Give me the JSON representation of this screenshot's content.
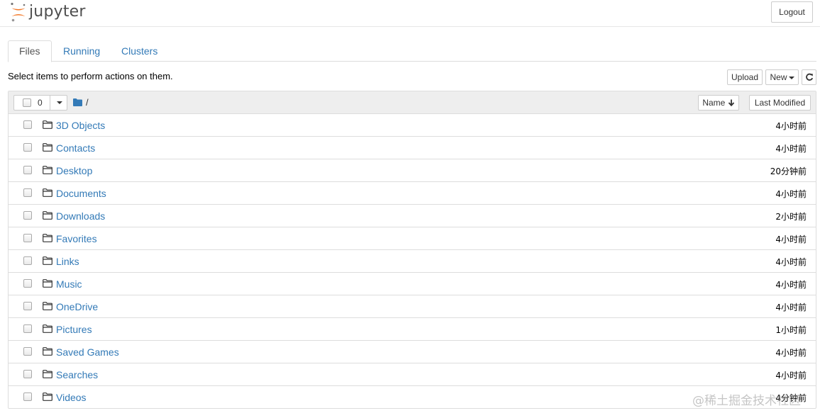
{
  "header": {
    "logo_text": "jupyter",
    "logout_label": "Logout"
  },
  "tabs": [
    {
      "label": "Files"
    },
    {
      "label": "Running"
    },
    {
      "label": "Clusters"
    }
  ],
  "toolbar": {
    "instructions": "Select items to perform actions on them.",
    "upload_label": "Upload",
    "new_label": "New"
  },
  "list_header": {
    "selected_count": "0",
    "breadcrumb_path": "/",
    "sort_name_label": "Name",
    "sort_modified_label": "Last Modified"
  },
  "items": [
    {
      "name": "3D Objects",
      "modified": "4小时前"
    },
    {
      "name": "Contacts",
      "modified": "4小时前"
    },
    {
      "name": "Desktop",
      "modified": "20分钟前"
    },
    {
      "name": "Documents",
      "modified": "4小时前"
    },
    {
      "name": "Downloads",
      "modified": "2小时前"
    },
    {
      "name": "Favorites",
      "modified": "4小时前"
    },
    {
      "name": "Links",
      "modified": "4小时前"
    },
    {
      "name": "Music",
      "modified": "4小时前"
    },
    {
      "name": "OneDrive",
      "modified": "4小时前"
    },
    {
      "name": "Pictures",
      "modified": "1小时前"
    },
    {
      "name": "Saved Games",
      "modified": "4小时前"
    },
    {
      "name": "Searches",
      "modified": "4小时前"
    },
    {
      "name": "Videos",
      "modified": "4分钟前"
    }
  ],
  "watermark": "@稀土掘金技术社区",
  "colors": {
    "link": "#337ab7",
    "logo_orange": "#f37726",
    "header_bg": "#eeeeee",
    "border": "#dddddd"
  },
  "icons": {
    "folder": "folder-outline-icon",
    "breadcrumb": "folder-solid-icon",
    "refresh": "refresh-icon",
    "sort": "arrow-down-icon"
  }
}
